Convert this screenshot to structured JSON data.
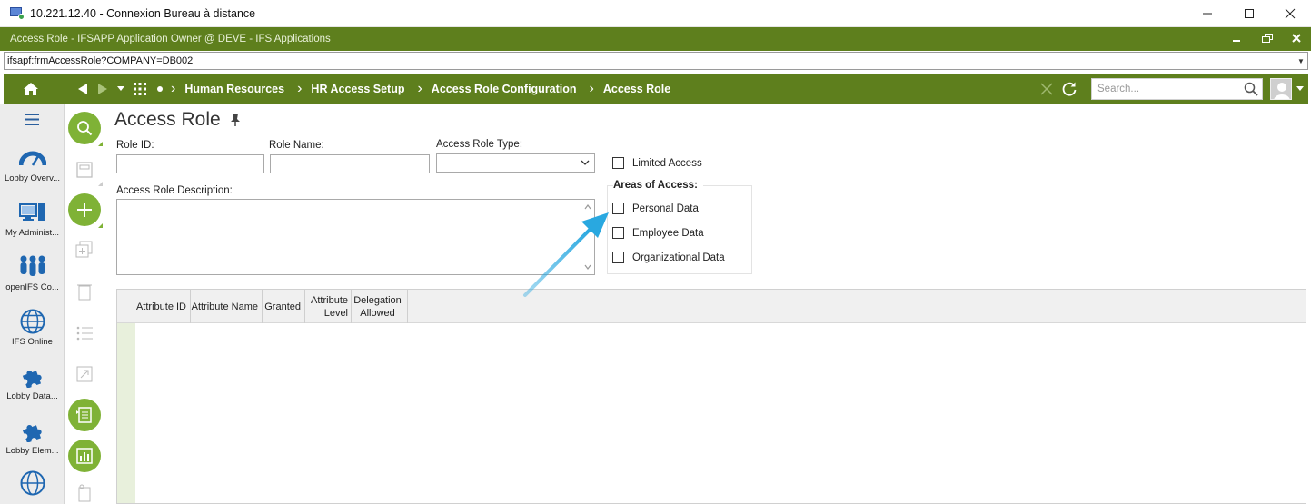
{
  "window": {
    "title": "10.221.12.40 - Connexion Bureau à distance",
    "minimize_icon": "minimize-icon",
    "maximize_icon": "maximize-icon",
    "close_icon": "close-icon"
  },
  "app": {
    "title": "Access Role - IFSAPP Application Owner @ DEVE - IFS Applications"
  },
  "address": {
    "value": "ifsapf:frmAccessRole?COMPANY=DB002"
  },
  "nav": {
    "breadcrumbs": [
      "Human Resources",
      "HR Access Setup",
      "Access Role Configuration",
      "Access Role"
    ],
    "search_placeholder": "Search..."
  },
  "lobby": {
    "items": [
      {
        "label": "Lobby Overv...",
        "icon": "gauge-icon"
      },
      {
        "label": "My Administ...",
        "icon": "computer-icon"
      },
      {
        "label": "openIFS Co...",
        "icon": "people-icon"
      },
      {
        "label": "IFS Online",
        "icon": "globe-icon"
      },
      {
        "label": "Lobby Data...",
        "icon": "puzzle-icon"
      },
      {
        "label": "Lobby Elem...",
        "icon": "puzzle-icon"
      },
      {
        "label": "",
        "icon": "globe-icon"
      }
    ]
  },
  "form": {
    "title": "Access Role",
    "role_id_label": "Role ID:",
    "role_id_value": "",
    "role_name_label": "Role Name:",
    "role_name_value": "",
    "access_role_type_label": "Access Role Type:",
    "access_role_type_value": "",
    "description_label": "Access Role Description:",
    "description_value": "",
    "limited_access_label": "Limited Access",
    "areas_title": "Areas of Access:",
    "areas": [
      "Personal Data",
      "Employee Data",
      "Organizational Data"
    ]
  },
  "grid": {
    "columns": [
      "Attribute ID",
      "Attribute Name",
      "Granted",
      "Attribute Level",
      "Delegation Allowed"
    ],
    "rows": []
  },
  "colors": {
    "brand_green": "#5e7f1d",
    "accent_green": "#7fb236",
    "annotation_arrow": "#29a8e0"
  }
}
